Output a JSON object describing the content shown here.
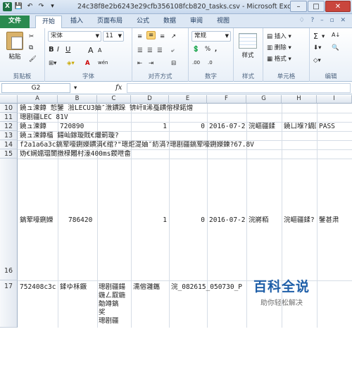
{
  "window": {
    "title": "24c38f8e2b6243e29cfb356108fcb820_tasks.csv - Microsoft Excel",
    "qat": [
      "X",
      "💾",
      "↶",
      "↷",
      "▾"
    ]
  },
  "tabs": [
    "文件",
    "开始",
    "插入",
    "页面布局",
    "公式",
    "数据",
    "审阅",
    "视图"
  ],
  "ribbon": {
    "clipboard": {
      "paste": "粘贴",
      "label": "剪贴板"
    },
    "font": {
      "name": "宋体",
      "size": "11",
      "label": "字体",
      "bold": "B",
      "italic": "I",
      "underline": "U",
      "grow": "A",
      "shrink": "A",
      "fill": "A",
      "wen": "wén"
    },
    "alignment": {
      "label": "对齐方式"
    },
    "number": {
      "format": "常规",
      "label": "数字",
      "percent": "%",
      "comma": ",",
      "inc": ".00",
      "dec": ".0"
    },
    "styles": {
      "label": "样式",
      "btn": "样式"
    },
    "cells": {
      "insert": "插入",
      "delete": "删除",
      "format": "格式",
      "label": "单元格"
    },
    "editing": {
      "sum": "Σ",
      "label": "编辑",
      "sort": "A↓",
      "find": "🔍"
    }
  },
  "formula_bar": {
    "name_box": "G2",
    "fx": "fx",
    "content": ""
  },
  "columns": [
    "A",
    "B",
    "C",
    "D",
    "E",
    "F",
    "G",
    "H",
    "I"
  ],
  "rows": {
    "r10": {
      "num": "10",
      "text": "鐃ュ湅鐏   悊鐾   湁LECU3妯″潡鏆跺   锛屽Ⅱ浠戞鏆傛椂鍩熷"
    },
    "r11": {
      "num": "11",
      "text": "璁剧疆LEC 81V"
    },
    "r12": {
      "num": "12",
      "a": "鐃ュ湅鐏",
      "b": "720890",
      "d": "1",
      "e": "0",
      "f": "2016-07-2",
      "g": "浣嶇疆鍒",
      "h": "鐃ㄩ堢?鍋囬",
      "i": "PASS"
    },
    "r13": {
      "num": "13",
      "text": "鐃ュ湅鐏楅     鍚屾鎵璇戝€熶箣璇?"
    },
    "r14": {
      "num": "14",
      "text": "f2a1a6a3c鎬荤嚎鍘嬫鏆涓€绾?\"璁炬湜妯″紡涓?璁剧疆鎬荤嚎鍘嬫鍊?67.8V"
    },
    "r15": {
      "num": "15",
      "text": "妫€娴嬬瑥閬撴椂闂村湪400ms鍐呭畬"
    },
    "r16": {
      "num": "16",
      "a": "鎬荤嚎鍘嬫",
      "b": "786420",
      "d": "1",
      "e": "0",
      "f": "2016-07-2",
      "g": "浣嶈粨",
      "h": "浣嶇疆鍒?",
      "i": "鐾甚肃"
    },
    "r17": {
      "num": "17",
      "a": "752408c3c",
      "b": "鍒ゆ柇鐝",
      "c": "璁剧疆鍚",
      "d": "濡傛灉鑴",
      "e": "浣_082615_050730_P"
    },
    "r17_wrap": [
      "鍦ㄥ叞鍦",
      "勪竴鎬",
      "奖",
      "璁剧疆"
    ]
  },
  "watermark": {
    "title": "百科全说",
    "subtitle": "助你轻松解决"
  }
}
